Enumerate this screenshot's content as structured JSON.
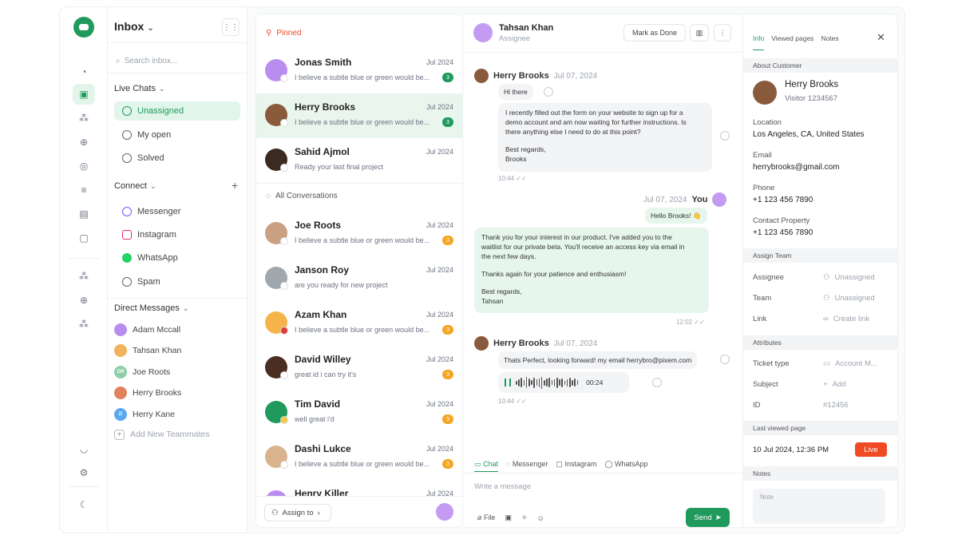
{
  "colors": {
    "accent": "#1f9a5c",
    "live": "#ef4a23",
    "badge_green": "#1f9a5c",
    "badge_orange": "#f5a623"
  },
  "sidebar": {
    "title": "Inbox",
    "search_placeholder": "Search inbox...",
    "live_chats_label": "Live Chats",
    "live_items": [
      {
        "label": "Unassigned",
        "icon": "user-circle-icon"
      },
      {
        "label": "My open",
        "icon": "inbox-icon"
      },
      {
        "label": "Solved",
        "icon": "check-circle-icon"
      }
    ],
    "connect_label": "Connect",
    "connect_items": [
      {
        "label": "Messenger",
        "icon": "messenger-icon"
      },
      {
        "label": "Instagram",
        "icon": "instagram-icon"
      },
      {
        "label": "WhatsApp",
        "icon": "whatsapp-icon"
      },
      {
        "label": "Spam",
        "icon": "spam-icon"
      }
    ],
    "dm_label": "Direct Messages",
    "dms": [
      {
        "name": "Adam Mccall"
      },
      {
        "name": "Tahsan Khan"
      },
      {
        "name": "Joe Roots",
        "initials": "DR"
      },
      {
        "name": "Herry Brooks"
      },
      {
        "name": "Herry Kane",
        "initials": "D"
      }
    ],
    "add_teammates": "Add New Teammates"
  },
  "list": {
    "pinned_label": "Pinned",
    "all_label": "All Conversations",
    "pinned": [
      {
        "name": "Jonas Smith",
        "date": "Jul 2024",
        "msg": "I believe a subtle blue or green would be...",
        "badge": "3"
      },
      {
        "name": "Herry Brooks",
        "date": "Jul 2024",
        "msg": "I believe a subtle blue or green would be...",
        "badge": "3"
      },
      {
        "name": "Sahid Ajmol",
        "date": "Jul 2024",
        "msg": "Ready your last final project",
        "badge": ""
      }
    ],
    "all": [
      {
        "name": "Joe Roots",
        "date": "Jul 2024",
        "msg": "I believe a subtle blue or green would be...",
        "badge": "3"
      },
      {
        "name": "Janson Roy",
        "date": "Jul 2024",
        "msg": "are you ready for new project",
        "badge": ""
      },
      {
        "name": "Azam Khan",
        "date": "Jul 2024",
        "msg": "I believe a subtle blue or green would be...",
        "badge": "3"
      },
      {
        "name": "David Willey",
        "date": "Jul 2024",
        "msg": "great id i can try it's",
        "badge": "3"
      },
      {
        "name": "Tim David",
        "date": "Jul 2024",
        "msg": "well great i'd",
        "badge": "3"
      },
      {
        "name": "Dashi Lukce",
        "date": "Jul 2024",
        "msg": "I believe a subtle blue or green would be...",
        "badge": "3"
      },
      {
        "name": "Henry Killer",
        "date": "Jul 2024",
        "msg": "",
        "badge": ""
      }
    ],
    "assign_label": "Assign to"
  },
  "chat": {
    "name": "Tahsan Khan",
    "sub": "Assignee",
    "mark_done": "Mark as Done",
    "m1": {
      "sender": "Herry Brooks",
      "time": "Jul 07, 2024",
      "greet": "Hi there",
      "lines": [
        "I recently filled out the form on your website to sign up for a",
        "demo account and am now waiting for further instructions. Is",
        "there anything else I need to do at this point?",
        "",
        "Best regards,",
        "Brooks"
      ],
      "stamp": "10:44"
    },
    "m2": {
      "sender": "You",
      "time": "Jul 07, 2024",
      "hello": "Hello Brooks! 👋",
      "lines": [
        "Thank you for your interest in our product. I've added you to the",
        "waitlist for our private beta. You'll receive an access key via email in",
        "the next few days.",
        "",
        "Thanks again for your patience and enthusiasm!",
        "",
        "Best regards,",
        "Tahsan"
      ],
      "stamp": "12:02"
    },
    "m3": {
      "sender": "Herry Brooks",
      "time": "Jul 07, 2024",
      "text": "Thats Perfect, looking forward! my email herrybro@pixem.com",
      "voice_dur": "00:24",
      "stamp": "10:44"
    },
    "channels": [
      "Chat",
      "Messenger",
      "Instagram",
      "WhatsApp"
    ],
    "compose_placeholder": "Write a message",
    "file_label": "File",
    "send_label": "Send"
  },
  "info": {
    "tabs": [
      "Info",
      "Viewed pages",
      "Notes"
    ],
    "about_label": "About Customer",
    "cust_name": "Herry Brooks",
    "cust_sub": "Visitor 1234567",
    "location_label": "Location",
    "location": "Los Angeles, CA, United States",
    "email_label": "Email",
    "email": "herrybrooks@gmail.com",
    "phone_label": "Phone",
    "phone": "+1 123 456 7890",
    "contact_label": "Contact Property",
    "contact": "+1 123 456 7890",
    "assign_team_label": "Assign Team",
    "assignee_label": "Assignee",
    "assignee": "Unassigned",
    "team_label": "Team",
    "team": "Unassigned",
    "link_label": "Link",
    "link": "Create link",
    "attributes_label": "Attributes",
    "ticket_label": "Ticket type",
    "ticket": "Account M...",
    "subject_label": "Subject",
    "subject": "Add",
    "id_label": "ID",
    "id": "#12456",
    "last_viewed_label": "Last viewed page",
    "last_viewed": "10 Jul 2024, 12:36 PM",
    "live": "Live",
    "notes_label": "Notes",
    "note_placeholder": "Note"
  }
}
